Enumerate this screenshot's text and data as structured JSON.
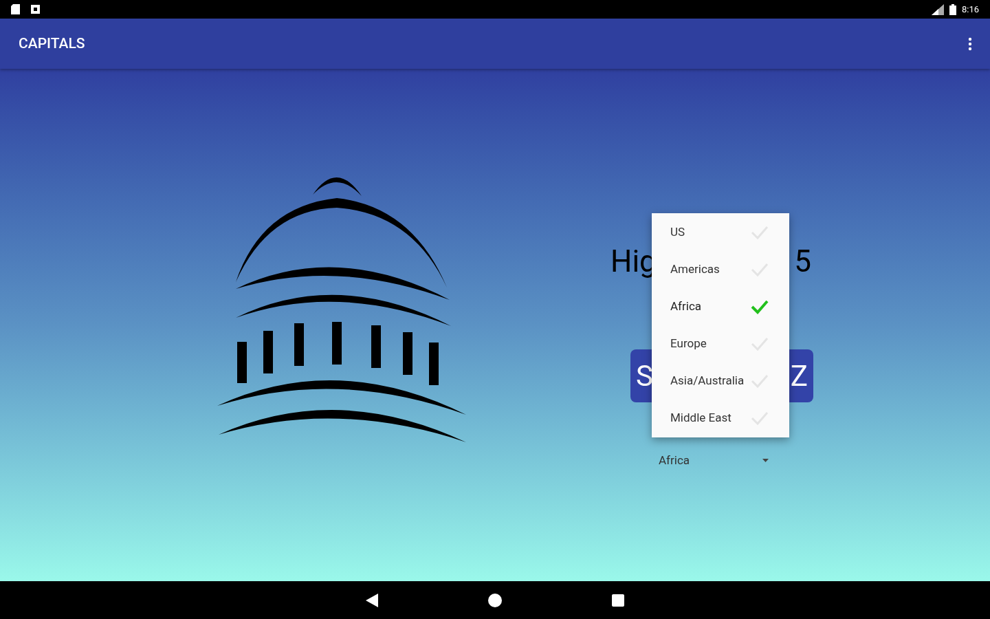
{
  "status_bar": {
    "time": "8:16"
  },
  "app_bar": {
    "title": "CAPITALS"
  },
  "high_score": {
    "visible_start": "Hig",
    "visible_end": "5"
  },
  "start_button": {
    "visible_start": "S",
    "visible_end": "Z"
  },
  "region_spinner": {
    "value": "Africa"
  },
  "region_menu": [
    {
      "label": "US",
      "selected": false
    },
    {
      "label": "Americas",
      "selected": false
    },
    {
      "label": "Africa",
      "selected": true
    },
    {
      "label": "Europe",
      "selected": false
    },
    {
      "label": "Asia/Australia",
      "selected": false
    },
    {
      "label": "Middle East",
      "selected": false
    }
  ]
}
